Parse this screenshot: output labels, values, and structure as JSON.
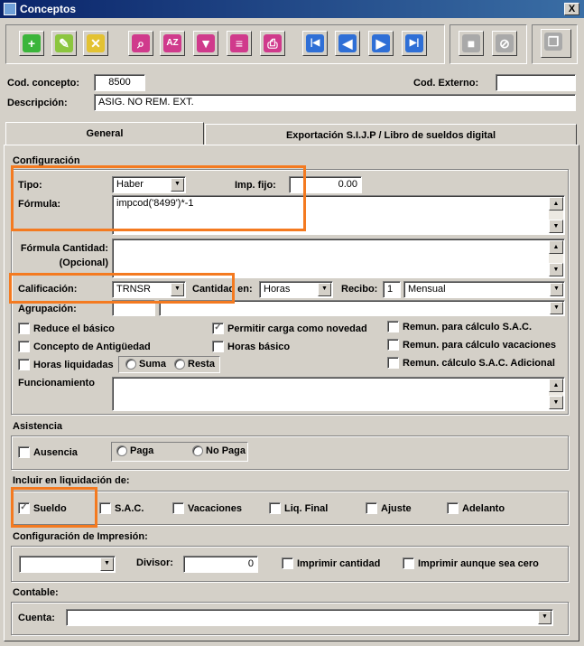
{
  "window": {
    "title": "Conceptos",
    "close": "X"
  },
  "toolbar": {
    "buttons": [
      {
        "name": "add-icon",
        "glyph": "+",
        "color": "green"
      },
      {
        "name": "edit-icon",
        "glyph": "✎",
        "color": "ygreen"
      },
      {
        "name": "delete-icon",
        "glyph": "✕",
        "color": "yellow"
      },
      {
        "name": "search-icon",
        "glyph": "⌕",
        "color": "pink"
      },
      {
        "name": "sort-icon",
        "glyph": "AZ",
        "color": "pink"
      },
      {
        "name": "filter-icon",
        "glyph": "▼",
        "color": "pink"
      },
      {
        "name": "report-icon",
        "glyph": "≡",
        "color": "pink"
      },
      {
        "name": "print-icon",
        "glyph": "⎙",
        "color": "pink"
      },
      {
        "name": "first-icon",
        "glyph": "|◀",
        "color": "blue"
      },
      {
        "name": "prev-icon",
        "glyph": "◀",
        "color": "blue"
      },
      {
        "name": "next-icon",
        "glyph": "▶",
        "color": "blue"
      },
      {
        "name": "last-icon",
        "glyph": "▶|",
        "color": "blue"
      },
      {
        "name": "save-icon",
        "glyph": "■",
        "color": "gray"
      },
      {
        "name": "cancel-icon",
        "glyph": "⊘",
        "color": "gray"
      },
      {
        "name": "copy-icon",
        "glyph": "❐",
        "color": "gray"
      }
    ]
  },
  "header": {
    "cod_concepto_label": "Cod. concepto:",
    "cod_concepto_value": "8500",
    "cod_externo_label": "Cod. Externo:",
    "cod_externo_value": "",
    "descripcion_label": "Descripción:",
    "descripcion_value": "ASIG. NO REM. EXT."
  },
  "tabs": [
    {
      "label": "General"
    },
    {
      "label": "Exportación S.I.J.P / Libro de sueldos digital"
    }
  ],
  "configuracion": {
    "title": "Configuración",
    "tipo_label": "Tipo:",
    "tipo_value": "Haber",
    "imp_fijo_label": "Imp. fijo:",
    "imp_fijo_value": "0.00",
    "formula_label": "Fórmula:",
    "formula_value": "impcod('8499')*-1",
    "formula_cantidad_label1": "Fórmula Cantidad:",
    "formula_cantidad_label2": "(Opcional)",
    "formula_cantidad_value": "",
    "calificacion_label": "Calificación:",
    "calificacion_value": "TRNSR",
    "cantidad_en_label": "Cantidad en:",
    "cantidad_en_value": "Horas",
    "recibo_label": "Recibo:",
    "recibo_value": "1",
    "recibo_periodo": "Mensual",
    "agrupacion_label": "Agrupación:",
    "agrupacion_code": "",
    "agrupacion_value": "",
    "checks": {
      "reduce_basico": {
        "label": "Reduce el básico",
        "checked": false
      },
      "concepto_antiguedad": {
        "label": "Concepto de Antigüedad",
        "checked": false
      },
      "horas_liquidadas": {
        "label": "Horas liquidadas",
        "checked": false
      },
      "permitir_carga": {
        "label": "Permitir carga como novedad",
        "checked": true
      },
      "horas_basico": {
        "label": "Horas básico",
        "checked": false
      },
      "remun_sac": {
        "label": "Remun. para cálculo S.A.C.",
        "checked": false
      },
      "remun_vacaciones": {
        "label": "Remun. para cálculo vacaciones",
        "checked": false
      },
      "remun_sac_adicional": {
        "label": "Remun. cálculo S.A.C. Adicional",
        "checked": false
      }
    },
    "suma_label": "Suma",
    "resta_label": "Resta",
    "funcionamiento_label": "Funcionamiento",
    "funcionamiento_value": ""
  },
  "asistencia": {
    "title": "Asistencia",
    "ausencia_label": "Ausencia",
    "paga_label": "Paga",
    "no_paga_label": "No Paga"
  },
  "liquidacion": {
    "title": "Incluir en liquidación de:",
    "items": [
      {
        "label": "Sueldo",
        "checked": true
      },
      {
        "label": "S.A.C.",
        "checked": false
      },
      {
        "label": "Vacaciones",
        "checked": false
      },
      {
        "label": "Liq. Final",
        "checked": false
      },
      {
        "label": "Ajuste",
        "checked": false
      },
      {
        "label": "Adelanto",
        "checked": false
      }
    ]
  },
  "impresion": {
    "title": "Configuración de Impresión:",
    "combo_value": "",
    "divisor_label": "Divisor:",
    "divisor_value": "0",
    "imprimir_cantidad": "Imprimir cantidad",
    "imprimir_cero": "Imprimir aunque sea cero"
  },
  "contable": {
    "title": "Contable:",
    "cuenta_label": "Cuenta:",
    "cuenta_value": ""
  },
  "colors": {
    "highlight": "#f47a20",
    "titlebar": "#0a246a",
    "face": "#d4d0c8"
  }
}
